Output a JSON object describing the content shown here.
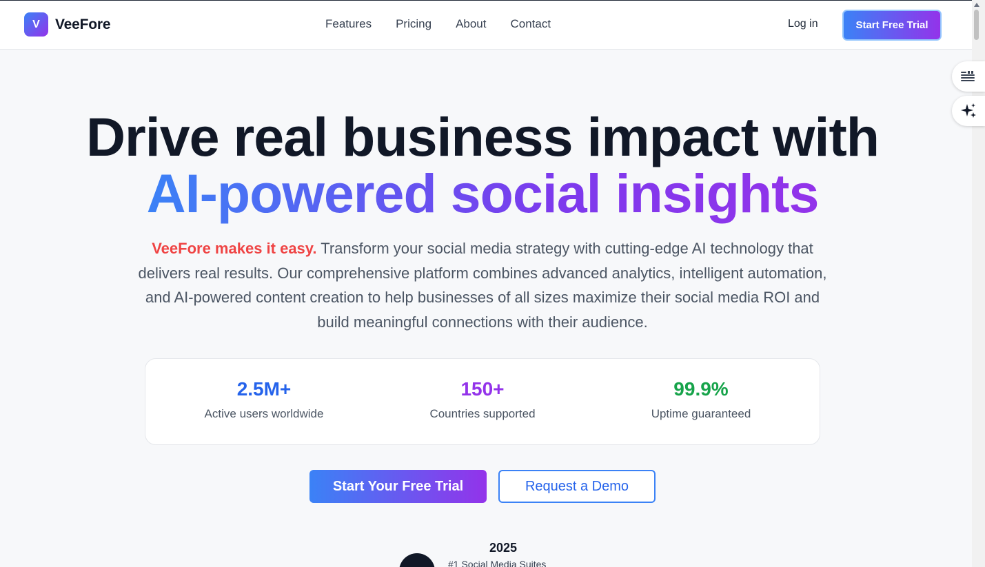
{
  "nav": {
    "logo_letter": "V",
    "brand": "VeeFore",
    "links": [
      "Features",
      "Pricing",
      "About",
      "Contact"
    ],
    "login": "Log in",
    "cta": "Start Free Trial"
  },
  "hero": {
    "title_line1": "Drive real business impact with",
    "title_line2": "AI-powered social insights",
    "lead_strong": "VeeFore makes it easy.",
    "lead_text": "Transform your social media strategy with cutting-edge AI technology that delivers real results. Our comprehensive platform combines advanced analytics, intelligent automation, and AI-powered content creation to help businesses of all sizes maximize their social media ROI and build meaningful connections with their audience."
  },
  "stats": [
    {
      "value": "2.5M+",
      "label": "Active users worldwide",
      "color": "#2563eb"
    },
    {
      "value": "150+",
      "label": "Countries supported",
      "color": "#9333ea"
    },
    {
      "value": "99.9%",
      "label": "Uptime guaranteed",
      "color": "#16a34a"
    }
  ],
  "buttons": {
    "primary": "Start Your Free Trial",
    "secondary": "Request a Demo"
  },
  "award": {
    "year": "2025",
    "text": "#1 Social Media Suites"
  },
  "floating": {
    "icons": [
      "reading-list-icon",
      "sparkle-icon"
    ]
  },
  "colors": {
    "gradient_start": "#3b82f6",
    "gradient_end": "#9333ea",
    "accent_red": "#ef4444"
  }
}
